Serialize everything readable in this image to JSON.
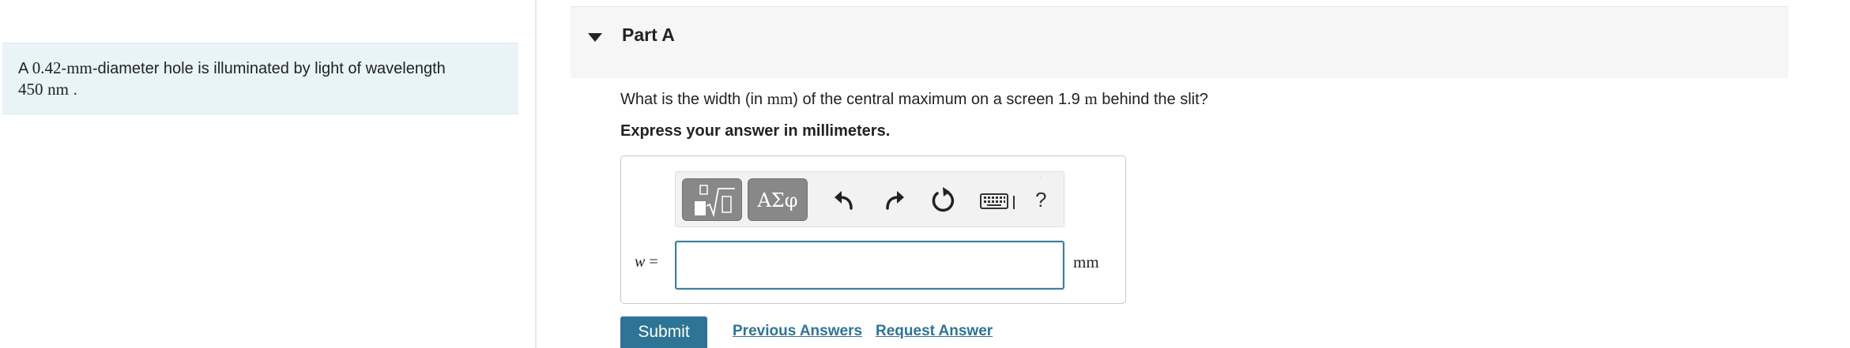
{
  "intro": {
    "prefix": "A ",
    "diameter": "0.42",
    "dash1": "-",
    "unit_mm": "mm",
    "text": "-diameter hole is illuminated by light of wavelength",
    "wavelength": "450",
    "unit_nm": "nm",
    "period": " ."
  },
  "part": {
    "title": "Part A"
  },
  "question": {
    "text_before": "What is the width (in ",
    "unit": "mm",
    "text_middle": ") of the central maximum on a screen 1.9 ",
    "distance_unit": "m",
    "text_after": " behind the slit?",
    "instruction": "Express your answer in millimeters."
  },
  "answer": {
    "variable": "w",
    "equals": " =",
    "value": "",
    "unit": "mm",
    "toolbar": {
      "greek_label": "ΑΣφ",
      "help_label": "?",
      "icons": [
        "templates-icon",
        "undo-icon",
        "redo-icon",
        "reset-icon",
        "keyboard-icon"
      ]
    }
  },
  "footer": {
    "submit_label": "Submit",
    "previous_answers_label": "Previous Answers",
    "request_answer_label": "Request Answer"
  },
  "colors": {
    "intro_bg": "#e8f4f6",
    "header_bg": "#f6f6f6",
    "accent": "#2e7494",
    "toolbar_button": "#888888"
  }
}
